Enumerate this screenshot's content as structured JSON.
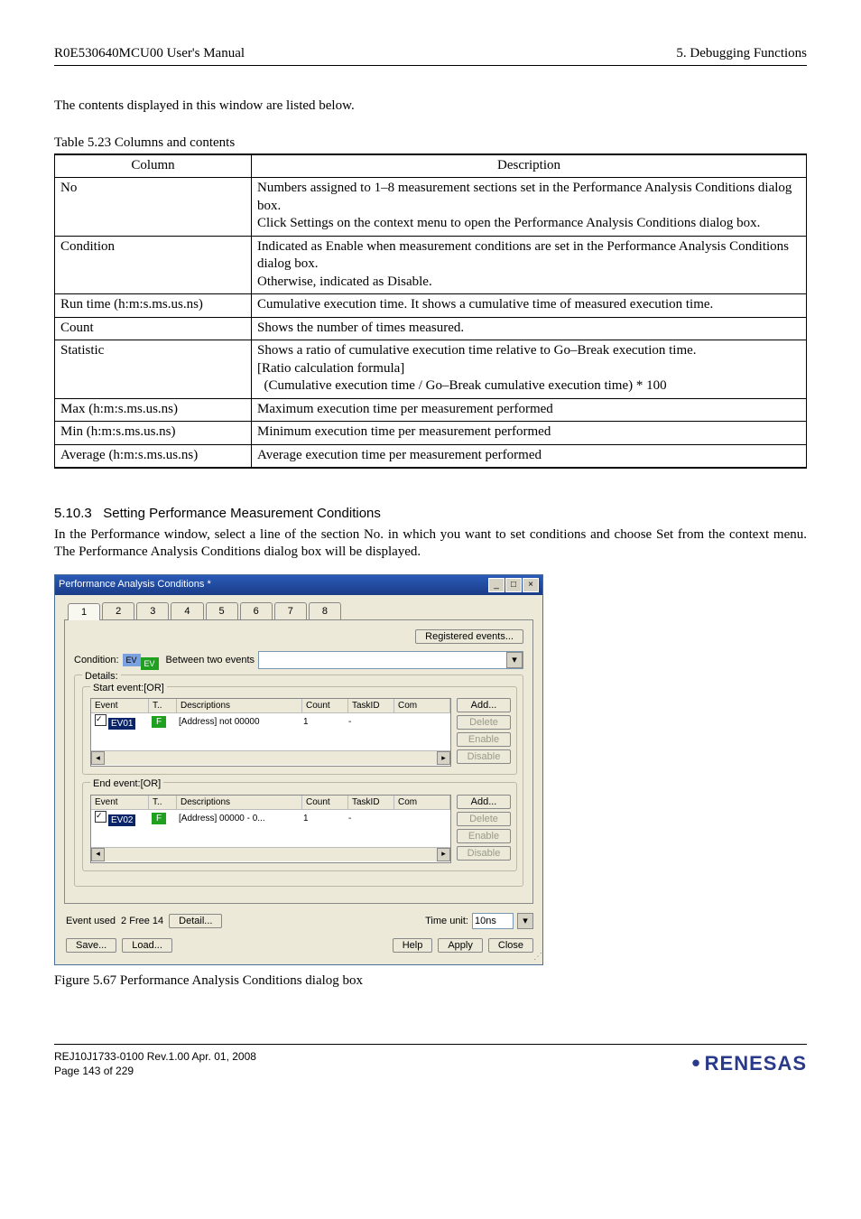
{
  "header": {
    "left": "R0E530640MCU00 User's Manual",
    "right": "5. Debugging Functions"
  },
  "intro": "The contents displayed in this window are listed below.",
  "table": {
    "caption": "Table 5.23 Columns and contents",
    "head": {
      "c1": "Column",
      "c2": "Description"
    },
    "rows": [
      {
        "c1": "No",
        "c2": "Numbers assigned to 1–8 measurement sections set in the Performance Analysis Conditions dialog box.\nClick Settings on the context menu to open the Performance Analysis Conditions dialog box."
      },
      {
        "c1": "Condition",
        "c2": "Indicated as Enable when measurement conditions are set in the Performance Analysis Conditions dialog box.\nOtherwise, indicated as Disable."
      },
      {
        "c1": "Run time (h:m:s.ms.us.ns)",
        "c2": "Cumulative execution time. It shows a cumulative time of measured execution time."
      },
      {
        "c1": "Count",
        "c2": "Shows the number of times measured."
      },
      {
        "c1": "Statistic",
        "c2": "Shows a ratio of cumulative execution time relative to Go–Break execution time.\n[Ratio calculation formula]\n  (Cumulative execution time / Go–Break cumulative execution time) * 100"
      },
      {
        "c1": "Max (h:m:s.ms.us.ns)",
        "c2": "Maximum execution time per measurement performed"
      },
      {
        "c1": "Min (h:m:s.ms.us.ns)",
        "c2": "Minimum execution time per measurement performed"
      },
      {
        "c1": "Average (h:m:s.ms.us.ns)",
        "c2": "Average execution time per measurement performed"
      }
    ]
  },
  "section": {
    "num": "5.10.3",
    "title": "Setting Performance Measurement Conditions",
    "body": "In the Performance window, select a line of the section No. in which you want to set conditions and choose Set from the context menu. The Performance Analysis Conditions dialog box will be displayed."
  },
  "dialog": {
    "title": "Performance Analysis Conditions *",
    "tabs": [
      "1",
      "2",
      "3",
      "4",
      "5",
      "6",
      "7",
      "8"
    ],
    "registered": "Registered events...",
    "cond_label": "Condition:",
    "ev1": "EV",
    "ev2": "EV",
    "between": "Between two events",
    "details": "Details:",
    "start_legend": "Start event:[OR]",
    "end_legend": "End event:[OR]",
    "cols": {
      "event": "Event",
      "t": "T..",
      "desc": "Descriptions",
      "count": "Count",
      "task": "TaskID",
      "com": "Com"
    },
    "start_row": {
      "ev": "EV01",
      "p": "F",
      "desc": "[Address] not 00000",
      "count": "1",
      "task": "-",
      "com": ""
    },
    "end_row": {
      "ev": "EV02",
      "p": "F",
      "desc": "[Address] 00000 - 0...",
      "count": "1",
      "task": "-",
      "com": ""
    },
    "btns": {
      "add": "Add...",
      "delete": "Delete",
      "enable": "Enable",
      "disable": "Disable"
    },
    "event_used": "Event used",
    "used_free": "2  Free 14",
    "detail": "Detail...",
    "time_unit_label": "Time unit:",
    "time_unit_value": "10ns",
    "save": "Save...",
    "load": "Load...",
    "help": "Help",
    "apply": "Apply",
    "close": "Close"
  },
  "fig_caption": "Figure 5.67 Performance Analysis Conditions dialog box",
  "footer": {
    "line1": "REJ10J1733-0100   Rev.1.00   Apr. 01, 2008",
    "line2": "Page 143 of 229",
    "brand": "RENESAS"
  }
}
